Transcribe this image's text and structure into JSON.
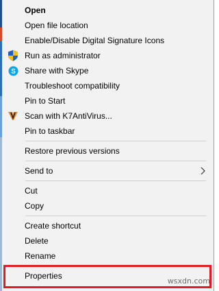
{
  "menu": {
    "items": [
      {
        "label": "Open"
      },
      {
        "label": "Open file location"
      },
      {
        "label": "Enable/Disable Digital Signature Icons"
      },
      {
        "label": "Run as administrator",
        "icon": "uac-shield-icon"
      },
      {
        "label": "Share with Skype",
        "icon": "skype-icon"
      },
      {
        "label": "Troubleshoot compatibility"
      },
      {
        "label": "Pin to Start"
      },
      {
        "label": "Scan with K7AntiVirus...",
        "icon": "k7-antivirus-icon"
      },
      {
        "label": "Pin to taskbar"
      },
      {
        "label": "Restore previous versions"
      },
      {
        "label": "Send to",
        "has_submenu": true
      },
      {
        "label": "Cut"
      },
      {
        "label": "Copy"
      },
      {
        "label": "Create shortcut"
      },
      {
        "label": "Delete"
      },
      {
        "label": "Rename"
      },
      {
        "label": "Properties",
        "highlighted": true
      }
    ]
  },
  "colors": {
    "menu_background": "#f2f2f2",
    "highlight_border": "#e01b24",
    "separator": "#cfcfcf"
  },
  "watermark": "wsxdn.com"
}
